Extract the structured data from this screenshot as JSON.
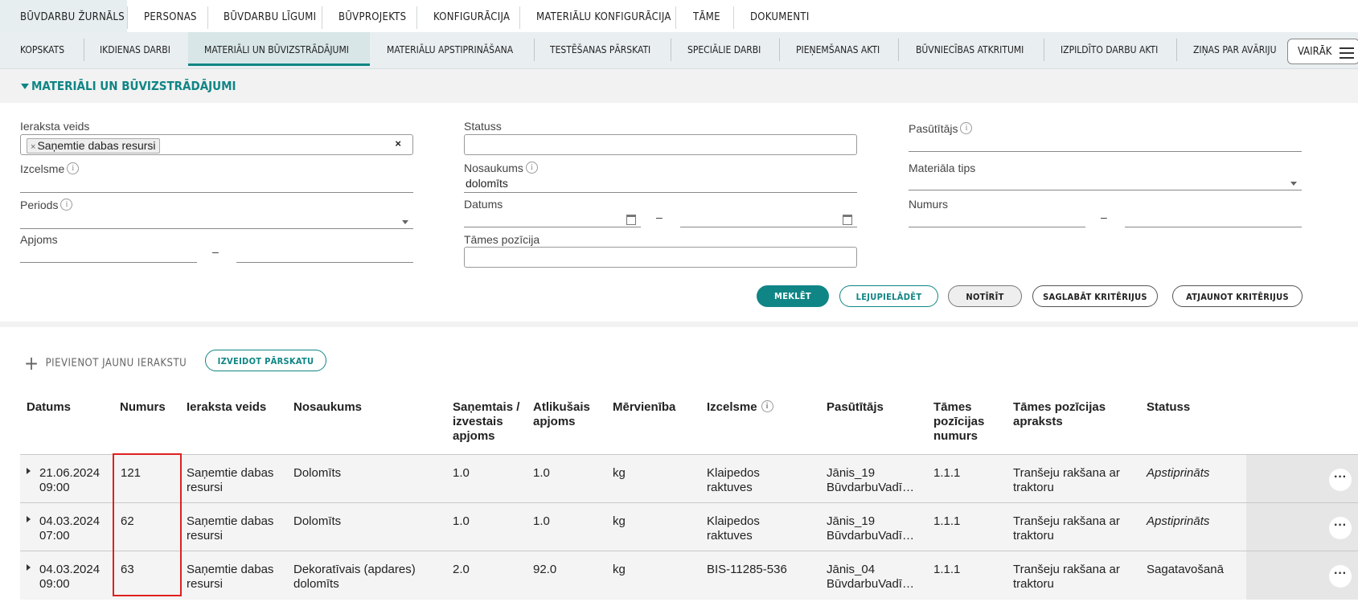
{
  "top_tabs": [
    "Būvdarbu žurnāls",
    "Personas",
    "Būvdarbu līgumi",
    "Būvprojekts",
    "Konfigurācija",
    "Materiālu konfigurācija",
    "Tāme",
    "Dokumenti"
  ],
  "sub_tabs": [
    "Kopskats",
    "Ikdienas darbi",
    "Materiāli un būvizstrādājumi",
    "Materiālu apstiprināšana",
    "Testēšanas pārskati",
    "Speciālie darbi",
    "Pieņemšanas akti",
    "Būvniecības atkritumi",
    "Izpildīto darbu akti",
    "Ziņas par avāriju"
  ],
  "more_label": "Vairāk",
  "section_title": "Materiāli un būvizstrādājumi",
  "filters": {
    "record_type_label": "Ieraksta veids",
    "record_type_chip": "Saņemtie dabas resursi",
    "origin_label": "Izcelsme",
    "period_label": "Periods",
    "volume_label": "Apjoms",
    "status_label": "Statuss",
    "name_label": "Nosaukums",
    "name_value": "dolomīts",
    "date_label": "Datums",
    "estimate_pos_label": "Tāmes pozīcija",
    "customer_label": "Pasūtītājs",
    "material_type_label": "Materiāla tips",
    "number_label": "Numurs",
    "range_dash": "–"
  },
  "actions": {
    "search": "Meklēt",
    "download": "Lejupielādēt",
    "clear": "Notīrīt",
    "save_criteria": "Saglabāt kritērijus",
    "restore_criteria": "Atjaunot kritērijus"
  },
  "add_new": "Pievienot jaunu ierakstu",
  "create_report": "Izveidot pārskatu",
  "table": {
    "headers": {
      "date": "Datums",
      "number": "Numurs",
      "type": "Ieraksta veids",
      "name": "Nosaukums",
      "received": "Saņemtais / izvestais apjoms",
      "remaining": "Atlikušais apjoms",
      "unit": "Mērvienība",
      "origin": "Izcelsme",
      "customer": "Pasūtītājs",
      "est_num": "Tāmes pozīcijas numurs",
      "est_desc": "Tāmes pozīcijas apraksts",
      "status": "Statuss"
    },
    "rows": [
      {
        "date": "21.06.2024",
        "time": "09:00",
        "number": "121",
        "type_1": "Saņemtie dabas",
        "type_2": "resursi",
        "name_1": "Dolomīts",
        "name_2": "",
        "received": "1.0",
        "remaining": "1.0",
        "unit": "kg",
        "origin_1": "Klaipedos",
        "origin_2": "raktuves",
        "customer_1": "Jānis_19",
        "customer_2": "BūvdarbuVadī…",
        "est_num": "1.1.1",
        "est_desc_1": "Tranšeju rakšana ar",
        "est_desc_2": "traktoru",
        "status": "Apstiprināts"
      },
      {
        "date": "04.03.2024",
        "time": "07:00",
        "number": "62",
        "type_1": "Saņemtie dabas",
        "type_2": "resursi",
        "name_1": "Dolomīts",
        "name_2": "",
        "received": "1.0",
        "remaining": "1.0",
        "unit": "kg",
        "origin_1": "Klaipedos",
        "origin_2": "raktuves",
        "customer_1": "Jānis_19",
        "customer_2": "BūvdarbuVadī…",
        "est_num": "1.1.1",
        "est_desc_1": "Tranšeju rakšana ar",
        "est_desc_2": "traktoru",
        "status": "Apstiprināts"
      },
      {
        "date": "04.03.2024",
        "time": "09:00",
        "number": "63",
        "type_1": "Saņemtie dabas",
        "type_2": "resursi",
        "name_1": "Dekoratīvais (apdares)",
        "name_2": "dolomīts",
        "received": "2.0",
        "remaining": "92.0",
        "unit": "kg",
        "origin_1": "BIS-11285-536",
        "origin_2": "",
        "customer_1": "Jānis_04",
        "customer_2": "BūvdarbuVadī…",
        "est_num": "1.1.1",
        "est_desc_1": "Tranšeju rakšana ar",
        "est_desc_2": "traktoru",
        "status": "Sagatavošanā"
      }
    ]
  },
  "colors": {
    "accent": "#108585",
    "approved": "#5fae9c",
    "highlight": "#e02020"
  }
}
